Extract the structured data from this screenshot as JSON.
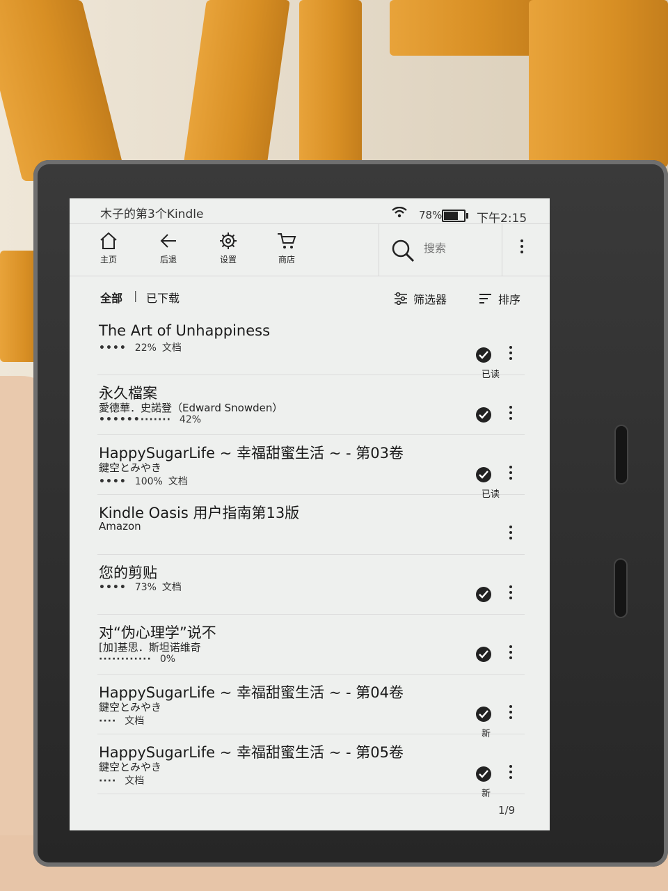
{
  "status": {
    "device_name": "木子的第3个Kindle",
    "battery_percent": "78%",
    "battery_level": 0.78,
    "time": "下午2:15"
  },
  "toolbar": {
    "home": "主页",
    "back": "后退",
    "settings": "设置",
    "store": "商店",
    "search_placeholder": "搜索"
  },
  "filters": {
    "all": "全部",
    "separator": "|",
    "downloaded": "已下载",
    "filter_label": "筛选器",
    "sort_label": "排序"
  },
  "items": [
    {
      "title": "The Art of Unhappiness",
      "author": "",
      "progress_dots": "••••",
      "percent": "22%",
      "type": "文档",
      "checked": true,
      "badge": "已读"
    },
    {
      "title": "永久檔案",
      "author": "愛德華．史諾登（Edward Snowden）",
      "progress_dots": "••••••·······",
      "percent": "42%",
      "type": "",
      "checked": true,
      "badge": ""
    },
    {
      "title": "HappySugarLife ~ 幸福甜蜜生活 ~ - 第03卷",
      "author": "鍵空とみやき",
      "progress_dots": "••••",
      "percent": "100%",
      "type": "文档",
      "checked": true,
      "badge": "已读"
    },
    {
      "title": "Kindle Oasis 用户指南第13版",
      "author": "Amazon",
      "progress_dots": "",
      "percent": "",
      "type": "",
      "checked": false,
      "badge": ""
    },
    {
      "title": "您的剪贴",
      "author": "",
      "progress_dots": "••••",
      "percent": "73%",
      "type": "文档",
      "checked": true,
      "badge": ""
    },
    {
      "title": "对“伪心理学”说不",
      "author": "[加]基思．斯坦诺维奇",
      "progress_dots": "············",
      "percent": "0%",
      "type": "",
      "checked": true,
      "badge": ""
    },
    {
      "title": "HappySugarLife ~ 幸福甜蜜生活 ~ - 第04卷",
      "author": "鍵空とみやき",
      "progress_dots": "····",
      "percent": "",
      "type": "文档",
      "checked": true,
      "badge": "新"
    },
    {
      "title": "HappySugarLife ~ 幸福甜蜜生活 ~ - 第05卷",
      "author": "鍵空とみやき",
      "progress_dots": "····",
      "percent": "",
      "type": "文档",
      "checked": true,
      "badge": "新"
    }
  ],
  "pager": "1/9"
}
